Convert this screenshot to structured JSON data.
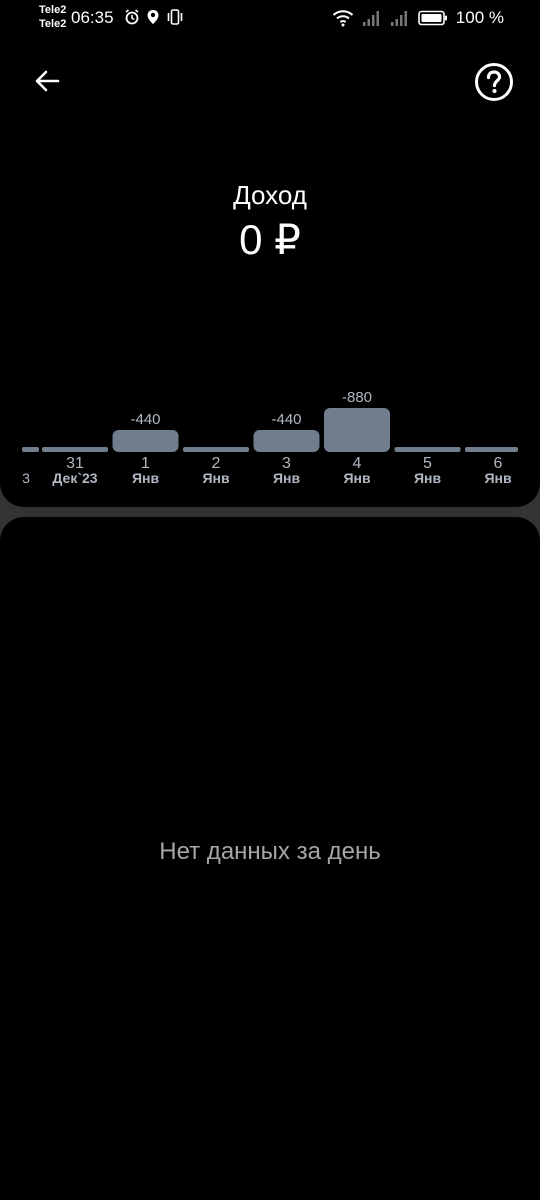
{
  "status_bar": {
    "carrier_1": "Tele2",
    "carrier_2": "Tele2",
    "time": "06:35",
    "battery": "100 %",
    "icons": [
      "alarm-icon",
      "location-icon",
      "vibrate-icon",
      "wifi-icon",
      "signal-icon",
      "signal-icon",
      "battery-icon"
    ]
  },
  "header": {
    "back_icon": "arrow-left-icon",
    "help_icon": "question-circle-icon"
  },
  "summary": {
    "title": "Доход",
    "amount": "0 ₽"
  },
  "chart_data": {
    "type": "bar",
    "categories": [
      {
        "day": "3",
        "month": ""
      },
      {
        "day": "31",
        "month": "Дек`23"
      },
      {
        "day": "1",
        "month": "Янв"
      },
      {
        "day": "2",
        "month": "Янв"
      },
      {
        "day": "3",
        "month": "Янв"
      },
      {
        "day": "4",
        "month": "Янв"
      },
      {
        "day": "5",
        "month": "Янв"
      },
      {
        "day": "6",
        "month": "Янв"
      }
    ],
    "values": [
      0,
      0,
      -440,
      0,
      -440,
      -880,
      0,
      0
    ],
    "value_labels": [
      "",
      "",
      "-440",
      "",
      "-440",
      "-880",
      "",
      ""
    ],
    "bar_color": "#6f7d8c",
    "label_color": "#b0b8c2"
  },
  "details": {
    "empty_message": "Нет данных за день"
  }
}
